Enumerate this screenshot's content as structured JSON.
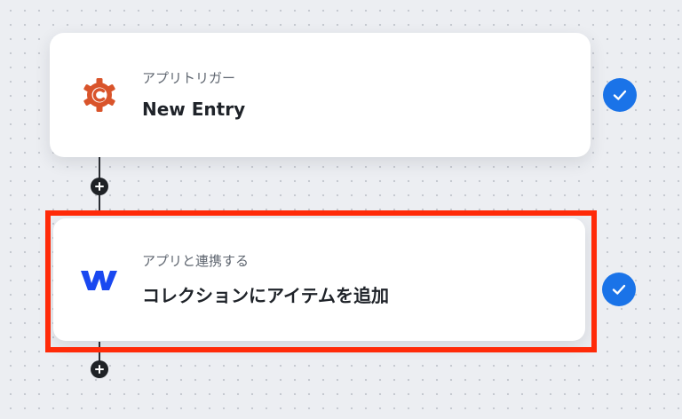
{
  "trigger": {
    "label": "アプリトリガー",
    "title": "New Entry",
    "app_icon": "cog-c-icon",
    "accent": "#d9542b"
  },
  "action": {
    "label": "アプリと連携する",
    "title": "コレクションにアイテムを追加",
    "app_icon": "webflow-w-icon",
    "accent": "#1a48f0"
  },
  "status_color": "#1a73e8",
  "highlight_color": "#ff2a08"
}
